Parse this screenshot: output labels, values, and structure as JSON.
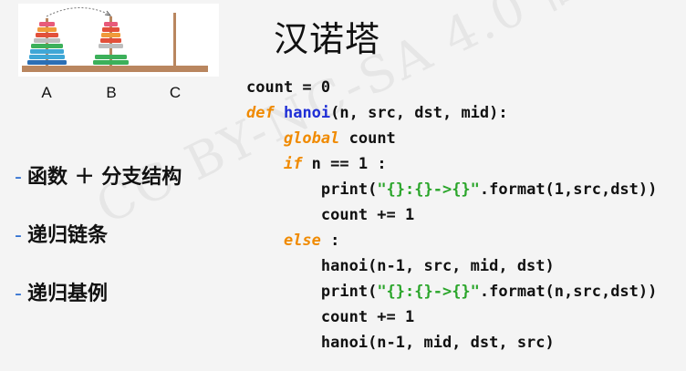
{
  "figure": {
    "peg_labels": [
      "A",
      "B",
      "C"
    ],
    "colors": {
      "base": "#b9865f",
      "peg": "#b9865f",
      "disk_blue_dark": "#2b6fb5",
      "disk_cyan": "#3fa7d6",
      "disk_green": "#3cb05a",
      "disk_gray": "#bdbdbd",
      "disk_red": "#e2503a",
      "disk_orange": "#f09a3a",
      "disk_pink": "#e85a7a"
    }
  },
  "title": "汉诺塔",
  "topics": [
    {
      "dash": "-",
      "text": "函数 ＋ 分支结构"
    },
    {
      "dash": "-",
      "text": "递归链条"
    },
    {
      "dash": "-",
      "text": "递归基例"
    }
  ],
  "watermark": "CC BY-NC-SA 4.0 嵩天",
  "code": {
    "l1": "count = 0",
    "l2_kw": "def",
    "l2_fn": "hanoi",
    "l2_rest": "(n, src, dst, mid):",
    "l3_kw": "global",
    "l3_rest": " count",
    "l4_kw": "if",
    "l4_rest": " n == 1 :",
    "l5_a": "print(",
    "l5_str": "\"{}:{}->{}\"",
    "l5_b": ".format(1,src,dst))",
    "l6": "count += 1",
    "l7_kw": "else",
    "l7_rest": " :",
    "l8": "hanoi(n-1, src, mid, dst)",
    "l9_a": "print(",
    "l9_str": "\"{}:{}->{}\"",
    "l9_b": ".format(n,src,dst))",
    "l10": "count += 1",
    "l11": "hanoi(n-1, mid, dst, src)"
  }
}
